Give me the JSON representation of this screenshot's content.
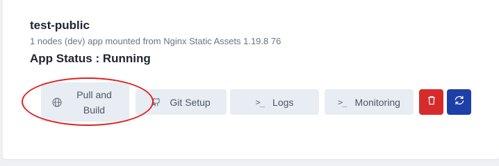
{
  "app": {
    "name": "test-public",
    "description": "1 nodes (dev) app mounted from Nginx Static Assets 1.19.8 76",
    "status_text": "App Status : Running"
  },
  "actions": {
    "pull_build_label": "Pull and Build",
    "git_setup_label": "Git Setup",
    "logs_label": "Logs",
    "monitoring_label": "Monitoring",
    "logs_icon_glyph": ">_",
    "monitoring_icon_glyph": ">_"
  },
  "icons": {
    "pull_build": "globe-icon",
    "git_setup": "github-icon",
    "logs": "terminal-icon",
    "monitoring": "terminal-icon",
    "delete": "trash-icon",
    "refresh": "refresh-icon"
  },
  "colors": {
    "delete_button": "#d62b2b",
    "refresh_button": "#1f3fa8",
    "action_button_bg": "#e8edf3",
    "annotation_circle": "#e02020"
  }
}
